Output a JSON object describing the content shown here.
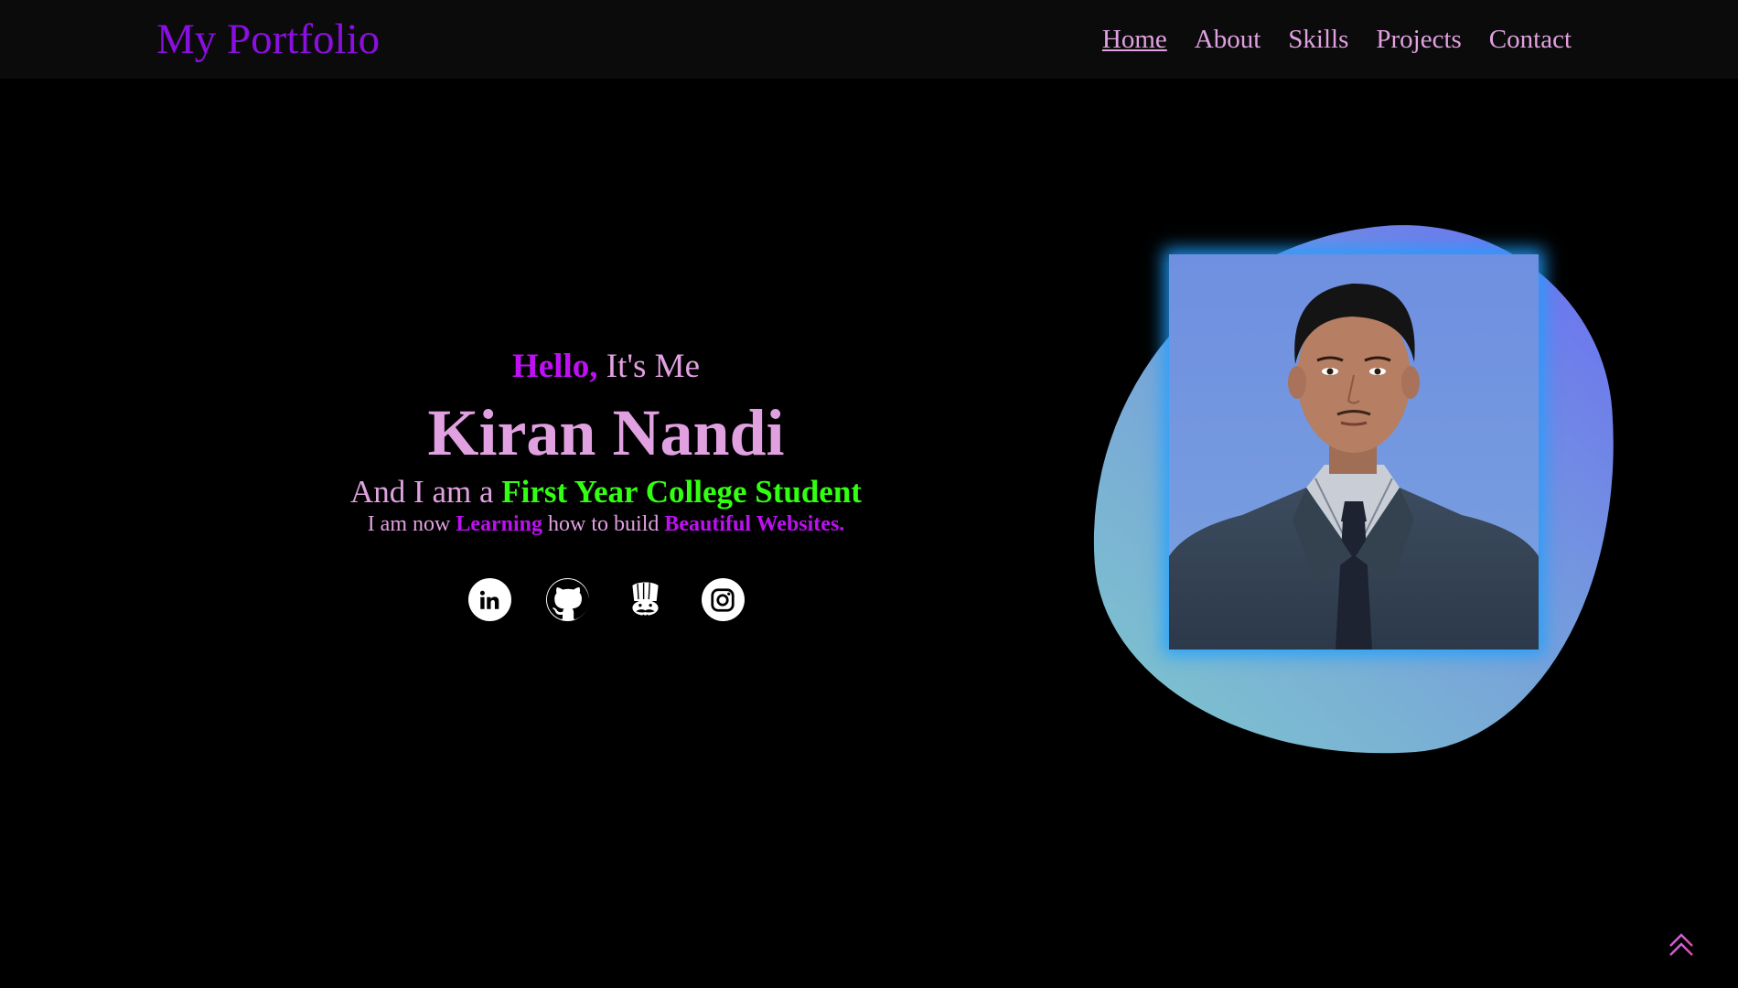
{
  "header": {
    "logo": "My Portfolio",
    "nav": [
      {
        "label": "Home",
        "active": true
      },
      {
        "label": "About",
        "active": false
      },
      {
        "label": "Skills",
        "active": false
      },
      {
        "label": "Projects",
        "active": false
      },
      {
        "label": "Contact",
        "active": false
      }
    ]
  },
  "hero": {
    "greeting_accent": "Hello,",
    "greeting_rest": " It's Me",
    "name": "Kiran Nandi",
    "role_prefix": "And I am a ",
    "role_highlight": "First Year College Student",
    "learning_prefix": "I am now ",
    "learning_word": "Learning",
    "learning_mid": " how to build ",
    "learning_target": "Beautiful Websites."
  },
  "socials": [
    {
      "icon": "linkedin-icon"
    },
    {
      "icon": "github-icon"
    },
    {
      "icon": "codechef-icon"
    },
    {
      "icon": "instagram-icon"
    }
  ],
  "colors": {
    "background": "#000000",
    "navbar": "#0b0b0b",
    "logo": "#8a0fe0",
    "text": "#e1a1e1",
    "accent_purple": "#bf10f3",
    "accent_green": "#33ff13",
    "blob_gradient_start": "#6a6df2",
    "blob_gradient_end": "#7ec8cc",
    "photo_glow": "#1ea0ff"
  },
  "back_to_top": {
    "icon": "double-chevron-up-icon"
  }
}
